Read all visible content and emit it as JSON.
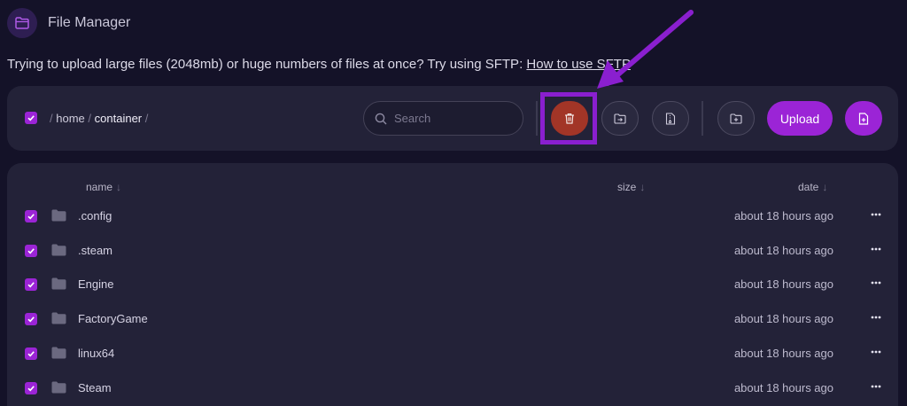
{
  "header": {
    "title": "File Manager",
    "icon": "folder-icon"
  },
  "notice": {
    "text": "Trying to upload large files (2048mb) or huge numbers of files at once? Try using SFTP: ",
    "link": "How to use SFTP"
  },
  "toolbar": {
    "breadcrumb": {
      "sep": "/",
      "home": "home",
      "container": "container"
    },
    "search": {
      "placeholder": "Search",
      "value": ""
    },
    "upload_label": "Upload"
  },
  "list": {
    "headers": {
      "name": "name",
      "size": "size",
      "date": "date",
      "sort_arrow": "↓"
    },
    "rows": [
      {
        "name": ".config",
        "date": "about 18 hours ago"
      },
      {
        "name": ".steam",
        "date": "about 18 hours ago"
      },
      {
        "name": "Engine",
        "date": "about 18 hours ago"
      },
      {
        "name": "FactoryGame",
        "date": "about 18 hours ago"
      },
      {
        "name": "linux64",
        "date": "about 18 hours ago"
      },
      {
        "name": "Steam",
        "date": "about 18 hours ago"
      }
    ]
  },
  "colors": {
    "accent": "#9b24d6",
    "delete": "#a23527",
    "background": "#141228",
    "panel": "#232238"
  }
}
